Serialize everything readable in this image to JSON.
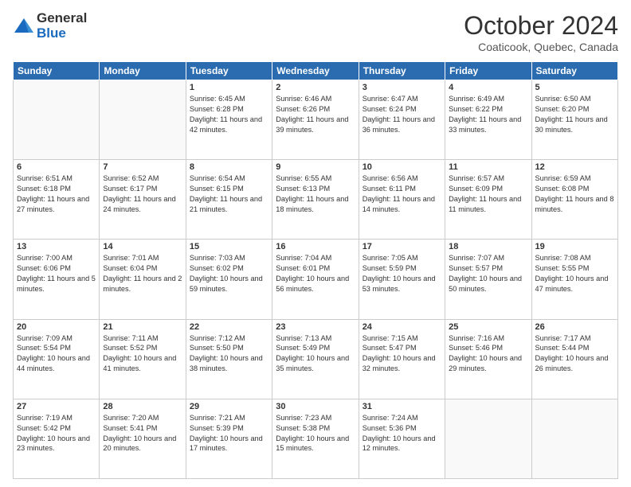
{
  "header": {
    "logo_general": "General",
    "logo_blue": "Blue",
    "title": "October 2024",
    "location": "Coaticook, Quebec, Canada"
  },
  "days_of_week": [
    "Sunday",
    "Monday",
    "Tuesday",
    "Wednesday",
    "Thursday",
    "Friday",
    "Saturday"
  ],
  "weeks": [
    [
      {
        "day": "",
        "sunrise": "",
        "sunset": "",
        "daylight": ""
      },
      {
        "day": "",
        "sunrise": "",
        "sunset": "",
        "daylight": ""
      },
      {
        "day": "1",
        "sunrise": "Sunrise: 6:45 AM",
        "sunset": "Sunset: 6:28 PM",
        "daylight": "Daylight: 11 hours and 42 minutes."
      },
      {
        "day": "2",
        "sunrise": "Sunrise: 6:46 AM",
        "sunset": "Sunset: 6:26 PM",
        "daylight": "Daylight: 11 hours and 39 minutes."
      },
      {
        "day": "3",
        "sunrise": "Sunrise: 6:47 AM",
        "sunset": "Sunset: 6:24 PM",
        "daylight": "Daylight: 11 hours and 36 minutes."
      },
      {
        "day": "4",
        "sunrise": "Sunrise: 6:49 AM",
        "sunset": "Sunset: 6:22 PM",
        "daylight": "Daylight: 11 hours and 33 minutes."
      },
      {
        "day": "5",
        "sunrise": "Sunrise: 6:50 AM",
        "sunset": "Sunset: 6:20 PM",
        "daylight": "Daylight: 11 hours and 30 minutes."
      }
    ],
    [
      {
        "day": "6",
        "sunrise": "Sunrise: 6:51 AM",
        "sunset": "Sunset: 6:18 PM",
        "daylight": "Daylight: 11 hours and 27 minutes."
      },
      {
        "day": "7",
        "sunrise": "Sunrise: 6:52 AM",
        "sunset": "Sunset: 6:17 PM",
        "daylight": "Daylight: 11 hours and 24 minutes."
      },
      {
        "day": "8",
        "sunrise": "Sunrise: 6:54 AM",
        "sunset": "Sunset: 6:15 PM",
        "daylight": "Daylight: 11 hours and 21 minutes."
      },
      {
        "day": "9",
        "sunrise": "Sunrise: 6:55 AM",
        "sunset": "Sunset: 6:13 PM",
        "daylight": "Daylight: 11 hours and 18 minutes."
      },
      {
        "day": "10",
        "sunrise": "Sunrise: 6:56 AM",
        "sunset": "Sunset: 6:11 PM",
        "daylight": "Daylight: 11 hours and 14 minutes."
      },
      {
        "day": "11",
        "sunrise": "Sunrise: 6:57 AM",
        "sunset": "Sunset: 6:09 PM",
        "daylight": "Daylight: 11 hours and 11 minutes."
      },
      {
        "day": "12",
        "sunrise": "Sunrise: 6:59 AM",
        "sunset": "Sunset: 6:08 PM",
        "daylight": "Daylight: 11 hours and 8 minutes."
      }
    ],
    [
      {
        "day": "13",
        "sunrise": "Sunrise: 7:00 AM",
        "sunset": "Sunset: 6:06 PM",
        "daylight": "Daylight: 11 hours and 5 minutes."
      },
      {
        "day": "14",
        "sunrise": "Sunrise: 7:01 AM",
        "sunset": "Sunset: 6:04 PM",
        "daylight": "Daylight: 11 hours and 2 minutes."
      },
      {
        "day": "15",
        "sunrise": "Sunrise: 7:03 AM",
        "sunset": "Sunset: 6:02 PM",
        "daylight": "Daylight: 10 hours and 59 minutes."
      },
      {
        "day": "16",
        "sunrise": "Sunrise: 7:04 AM",
        "sunset": "Sunset: 6:01 PM",
        "daylight": "Daylight: 10 hours and 56 minutes."
      },
      {
        "day": "17",
        "sunrise": "Sunrise: 7:05 AM",
        "sunset": "Sunset: 5:59 PM",
        "daylight": "Daylight: 10 hours and 53 minutes."
      },
      {
        "day": "18",
        "sunrise": "Sunrise: 7:07 AM",
        "sunset": "Sunset: 5:57 PM",
        "daylight": "Daylight: 10 hours and 50 minutes."
      },
      {
        "day": "19",
        "sunrise": "Sunrise: 7:08 AM",
        "sunset": "Sunset: 5:55 PM",
        "daylight": "Daylight: 10 hours and 47 minutes."
      }
    ],
    [
      {
        "day": "20",
        "sunrise": "Sunrise: 7:09 AM",
        "sunset": "Sunset: 5:54 PM",
        "daylight": "Daylight: 10 hours and 44 minutes."
      },
      {
        "day": "21",
        "sunrise": "Sunrise: 7:11 AM",
        "sunset": "Sunset: 5:52 PM",
        "daylight": "Daylight: 10 hours and 41 minutes."
      },
      {
        "day": "22",
        "sunrise": "Sunrise: 7:12 AM",
        "sunset": "Sunset: 5:50 PM",
        "daylight": "Daylight: 10 hours and 38 minutes."
      },
      {
        "day": "23",
        "sunrise": "Sunrise: 7:13 AM",
        "sunset": "Sunset: 5:49 PM",
        "daylight": "Daylight: 10 hours and 35 minutes."
      },
      {
        "day": "24",
        "sunrise": "Sunrise: 7:15 AM",
        "sunset": "Sunset: 5:47 PM",
        "daylight": "Daylight: 10 hours and 32 minutes."
      },
      {
        "day": "25",
        "sunrise": "Sunrise: 7:16 AM",
        "sunset": "Sunset: 5:46 PM",
        "daylight": "Daylight: 10 hours and 29 minutes."
      },
      {
        "day": "26",
        "sunrise": "Sunrise: 7:17 AM",
        "sunset": "Sunset: 5:44 PM",
        "daylight": "Daylight: 10 hours and 26 minutes."
      }
    ],
    [
      {
        "day": "27",
        "sunrise": "Sunrise: 7:19 AM",
        "sunset": "Sunset: 5:42 PM",
        "daylight": "Daylight: 10 hours and 23 minutes."
      },
      {
        "day": "28",
        "sunrise": "Sunrise: 7:20 AM",
        "sunset": "Sunset: 5:41 PM",
        "daylight": "Daylight: 10 hours and 20 minutes."
      },
      {
        "day": "29",
        "sunrise": "Sunrise: 7:21 AM",
        "sunset": "Sunset: 5:39 PM",
        "daylight": "Daylight: 10 hours and 17 minutes."
      },
      {
        "day": "30",
        "sunrise": "Sunrise: 7:23 AM",
        "sunset": "Sunset: 5:38 PM",
        "daylight": "Daylight: 10 hours and 15 minutes."
      },
      {
        "day": "31",
        "sunrise": "Sunrise: 7:24 AM",
        "sunset": "Sunset: 5:36 PM",
        "daylight": "Daylight: 10 hours and 12 minutes."
      },
      {
        "day": "",
        "sunrise": "",
        "sunset": "",
        "daylight": ""
      },
      {
        "day": "",
        "sunrise": "",
        "sunset": "",
        "daylight": ""
      }
    ]
  ]
}
